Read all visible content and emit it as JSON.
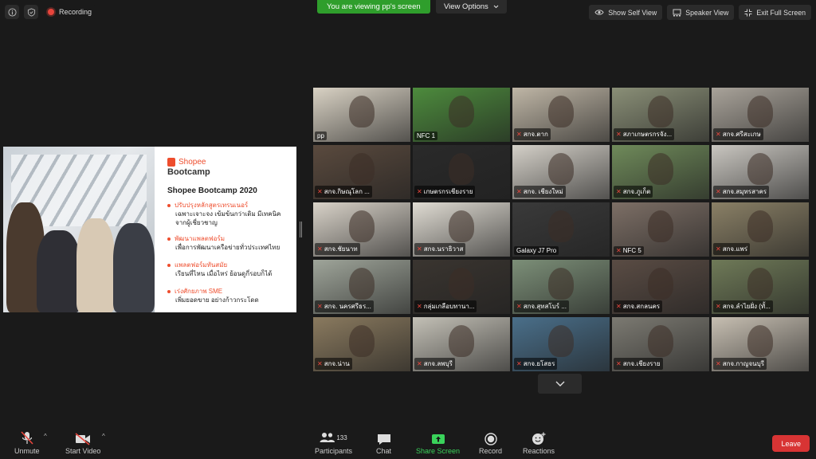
{
  "topbar": {
    "recording_label": "Recording",
    "viewing_banner": "You are viewing pp's screen",
    "view_options": "View Options",
    "show_self_view": "Show Self View",
    "speaker_view": "Speaker View",
    "exit_full_screen": "Exit Full Screen"
  },
  "share": {
    "brand": "Shopee",
    "subbrand": "Bootcamp",
    "title": "Shopee Bootcamp 2020",
    "bullets": [
      {
        "h": "ปรับปรุงหลักสูตรเทรนเนอร์",
        "b": "เฉพาะเจาะจง เข้มข้นกว่าเดิม มีเทคนิคจากผู้เชี่ยวชาญ"
      },
      {
        "h": "พัฒนาแพลตฟอร์ม",
        "b": "เพื่อการพัฒนาเครือข่ายทั่วประเทศไทย"
      },
      {
        "h": "แพลตฟอร์มทันสมัย",
        "b": "เรียนที่ไหน เมื่อไหร่ ย้อนดูกี่รอบก็ได้"
      },
      {
        "h": "เร่งศักยภาพ SME",
        "b": "เพิ่มยอดขาย อย่างก้าวกระโดด"
      }
    ]
  },
  "gallery": {
    "tiles": [
      {
        "name": "pp",
        "muted": false,
        "active": true,
        "color": "#d9d2c4"
      },
      {
        "name": "NFC 1",
        "muted": false,
        "active": false,
        "color": "#4d8b3d"
      },
      {
        "name": "สกจ.ตาก",
        "muted": true,
        "active": false,
        "color": "#bfb6a6"
      },
      {
        "name": "สภาเกษตรกรจัง...",
        "muted": true,
        "active": false,
        "color": "#8a8f77"
      },
      {
        "name": "สกจ.ศรีสะเกษ",
        "muted": true,
        "active": false,
        "color": "#a9a39a"
      },
      {
        "name": "สกจ.กิษณุโลก ...",
        "muted": true,
        "active": false,
        "color": "#5a4a3e"
      },
      {
        "name": "เกษตรกรเชียงราย",
        "muted": true,
        "active": false,
        "color": "#2a2a2a"
      },
      {
        "name": "สกจ. เชียงใหม่",
        "muted": true,
        "active": false,
        "color": "#d4d0c8"
      },
      {
        "name": "สกจ.ภูเก็ต",
        "muted": true,
        "active": false,
        "color": "#6f8a5a"
      },
      {
        "name": "สกจ.สมุทรสาคร",
        "muted": true,
        "active": false,
        "color": "#c9c6c0"
      },
      {
        "name": "สกจ.ชัยนาท",
        "muted": true,
        "active": false,
        "color": "#d8d2c8"
      },
      {
        "name": "สกจ.นราธิวาส",
        "muted": true,
        "active": false,
        "color": "#e0dcd3"
      },
      {
        "name": "Galaxy J7 Pro",
        "muted": false,
        "active": false,
        "color": "#3a3a3a"
      },
      {
        "name": "NFC 5",
        "muted": true,
        "active": false,
        "color": "#7d6f66"
      },
      {
        "name": "สกจ.แพร่",
        "muted": true,
        "active": false,
        "color": "#8a8066"
      },
      {
        "name": "สกจ. นครศรีธร...",
        "muted": true,
        "active": false,
        "color": "#9fa59a"
      },
      {
        "name": "กลุ่มเกลือบทานา...",
        "muted": true,
        "active": false,
        "color": "#3a3530"
      },
      {
        "name": "สกจ.สุทสโบร์ ...",
        "muted": true,
        "active": false,
        "color": "#7c8f78"
      },
      {
        "name": "สกจ.สกลนคร",
        "muted": true,
        "active": false,
        "color": "#5a4c44"
      },
      {
        "name": "สกจ.ลำไยฝั่ง (ทั้...",
        "muted": true,
        "active": false,
        "color": "#6f7a58"
      },
      {
        "name": "สกจ.น่าน",
        "muted": true,
        "active": false,
        "color": "#8a7a5f"
      },
      {
        "name": "สกจ.ลพบุรี",
        "muted": true,
        "active": false,
        "color": "#c3c0b6"
      },
      {
        "name": "สกจ.ยโสธร",
        "muted": true,
        "active": false,
        "color": "#4a6f8a"
      },
      {
        "name": "สกจ.เชียงราย",
        "muted": true,
        "active": false,
        "color": "#7c7a72"
      },
      {
        "name": "สกจ.กาญจนบุรี",
        "muted": true,
        "active": false,
        "color": "#c7bfb2"
      }
    ]
  },
  "toolbar": {
    "unmute": "Unmute",
    "start_video": "Start Video",
    "participants": "Participants",
    "participants_count": "133",
    "chat": "Chat",
    "share_screen": "Share Screen",
    "record": "Record",
    "reactions": "Reactions",
    "leave": "Leave"
  }
}
